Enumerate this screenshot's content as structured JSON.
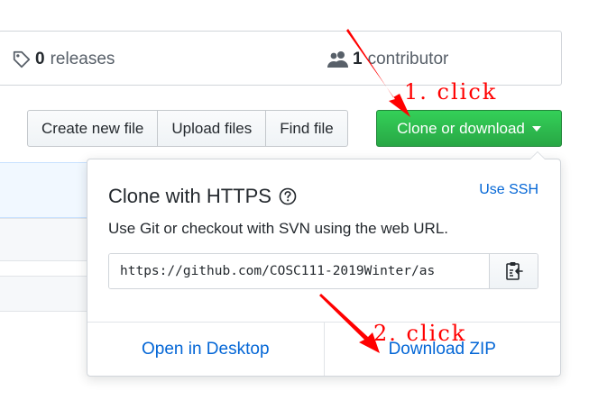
{
  "stats": {
    "releases_count": "0",
    "releases_label": "releases",
    "contributors_count": "1",
    "contributors_label": "contributor"
  },
  "toolbar": {
    "create_file": "Create new file",
    "upload_files": "Upload files",
    "find_file": "Find file",
    "clone_label": "Clone or download"
  },
  "clone_panel": {
    "title": "Clone with HTTPS",
    "use_ssh": "Use SSH",
    "description": "Use Git or checkout with SVN using the web URL.",
    "url": "https://github.com/COSC111-2019Winter/as",
    "open_desktop": "Open in Desktop",
    "download_zip": "Download ZIP"
  },
  "annotations": {
    "step1": "1. click",
    "step2": "2. click"
  },
  "colors": {
    "primary_green": "#28a745",
    "link_blue": "#0366d6",
    "annotation_red": "#ff0000"
  }
}
